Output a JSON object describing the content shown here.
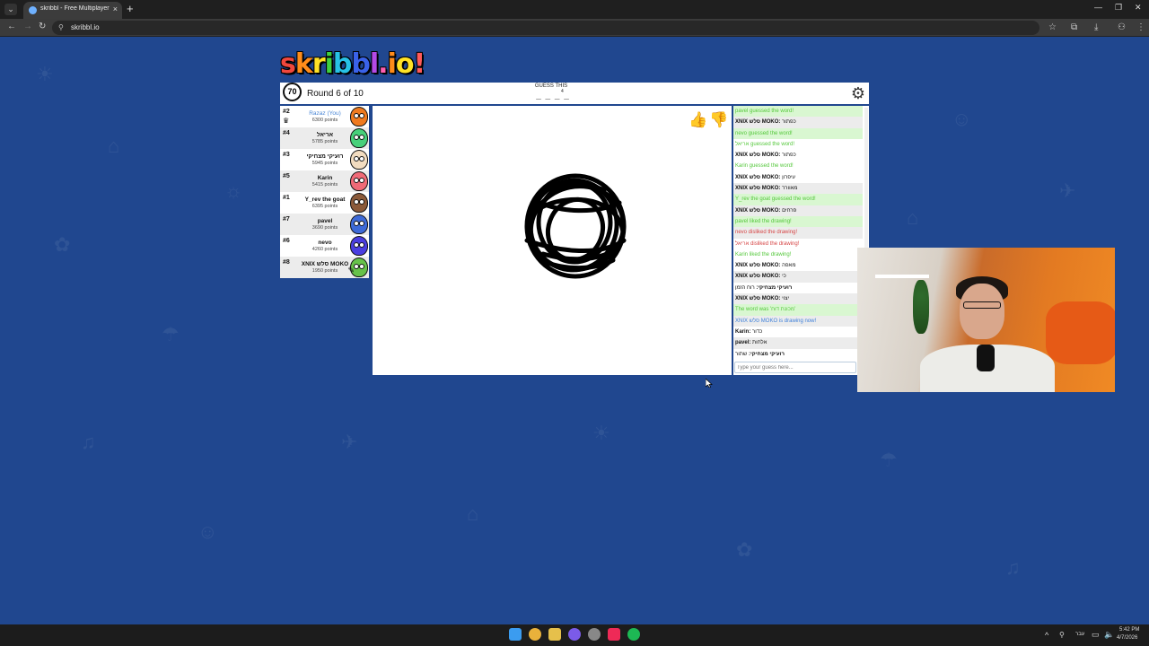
{
  "browser": {
    "tab_title": "skribbl - Free Multiplayer Drawi...",
    "url": "skribbl.io"
  },
  "game": {
    "logo": "skribbl.io",
    "timer": "70",
    "round": "Round 6 of 10",
    "guess_label": "GUESS THIS",
    "word_length": "4",
    "word_hint": "_ _ _ _",
    "players": [
      {
        "rank": "#2",
        "name": "Razaz (You)",
        "points": "6300 points",
        "you": true,
        "color": "#ef7a1f",
        "crown": true
      },
      {
        "rank": "#4",
        "name": "אריאל",
        "points": "5785 points",
        "color": "#47d07a"
      },
      {
        "rank": "#3",
        "name": "רועיקי מצחיקי",
        "points": "5945 points",
        "color": "#f2dcc0"
      },
      {
        "rank": "#5",
        "name": "Karin",
        "points": "5415 points",
        "color": "#ef6a77"
      },
      {
        "rank": "#1",
        "name": "Y_rev the goat",
        "points": "6395 points",
        "color": "#8b5a3a"
      },
      {
        "rank": "#7",
        "name": "pavel",
        "points": "3690 points",
        "color": "#3d6ad8"
      },
      {
        "rank": "#6",
        "name": "nevo",
        "points": "4260 points",
        "color": "#4a3ee0"
      },
      {
        "rank": "#8",
        "name": "XNIX סלש MOKO",
        "points": "1950 points",
        "color": "#67c24a",
        "drawing": true
      }
    ],
    "chat": [
      {
        "type": "green",
        "text": "pavel guessed the word!"
      },
      {
        "type": "plain",
        "sender": "XNIX סלש MOKO:",
        "text": "כפתור"
      },
      {
        "type": "green",
        "text": "nevo guessed the word!"
      },
      {
        "type": "green",
        "text": "אריאל guessed the word!"
      },
      {
        "type": "plain",
        "sender": "XNIX סלש MOKO:",
        "text": "כפתור"
      },
      {
        "type": "green",
        "text": "Karin guessed the word!"
      },
      {
        "type": "plain",
        "sender": "XNIX סלש MOKO:",
        "text": "עיפרון"
      },
      {
        "type": "plain",
        "sender": "XNIX סלש MOKO:",
        "text": "מאוורר"
      },
      {
        "type": "green",
        "text": "Y_rev the goat guessed the word!"
      },
      {
        "type": "plain",
        "sender": "XNIX סלש MOKO:",
        "text": "פרחים"
      },
      {
        "type": "green",
        "text": "pavel liked the drawing!"
      },
      {
        "type": "red",
        "text": "nevo disliked the drawing!"
      },
      {
        "type": "red",
        "text": "אריאל disliked the drawing!"
      },
      {
        "type": "green",
        "text": "Karin liked the drawing!"
      },
      {
        "type": "plain",
        "sender": "XNIX סלש MOKO:",
        "text": "מאפה"
      },
      {
        "type": "plain",
        "sender": "XNIX סלש MOKO:",
        "text": "כי"
      },
      {
        "type": "plain",
        "sender": "רועיקי מצחיקי:",
        "text": "רוח הזמן"
      },
      {
        "type": "plain",
        "sender": "XNIX סלש MOKO:",
        "text": "יצוי"
      },
      {
        "type": "green",
        "text": "The word was 'מכונת דוח'"
      },
      {
        "type": "blue",
        "text": "XNIX סלש MOKO is drawing now!"
      },
      {
        "type": "plain",
        "sender": "Karin:",
        "text": "כדור"
      },
      {
        "type": "plain",
        "sender": "pavel:",
        "text": "אלחות"
      },
      {
        "type": "plain",
        "sender": "רועיקי מצחיקי:",
        "text": "שתור"
      }
    ],
    "chat_placeholder": "Type your guess here..."
  },
  "taskbar": {
    "lang": "עבר",
    "time": "5:42 PM",
    "date": "4/7/2026"
  }
}
